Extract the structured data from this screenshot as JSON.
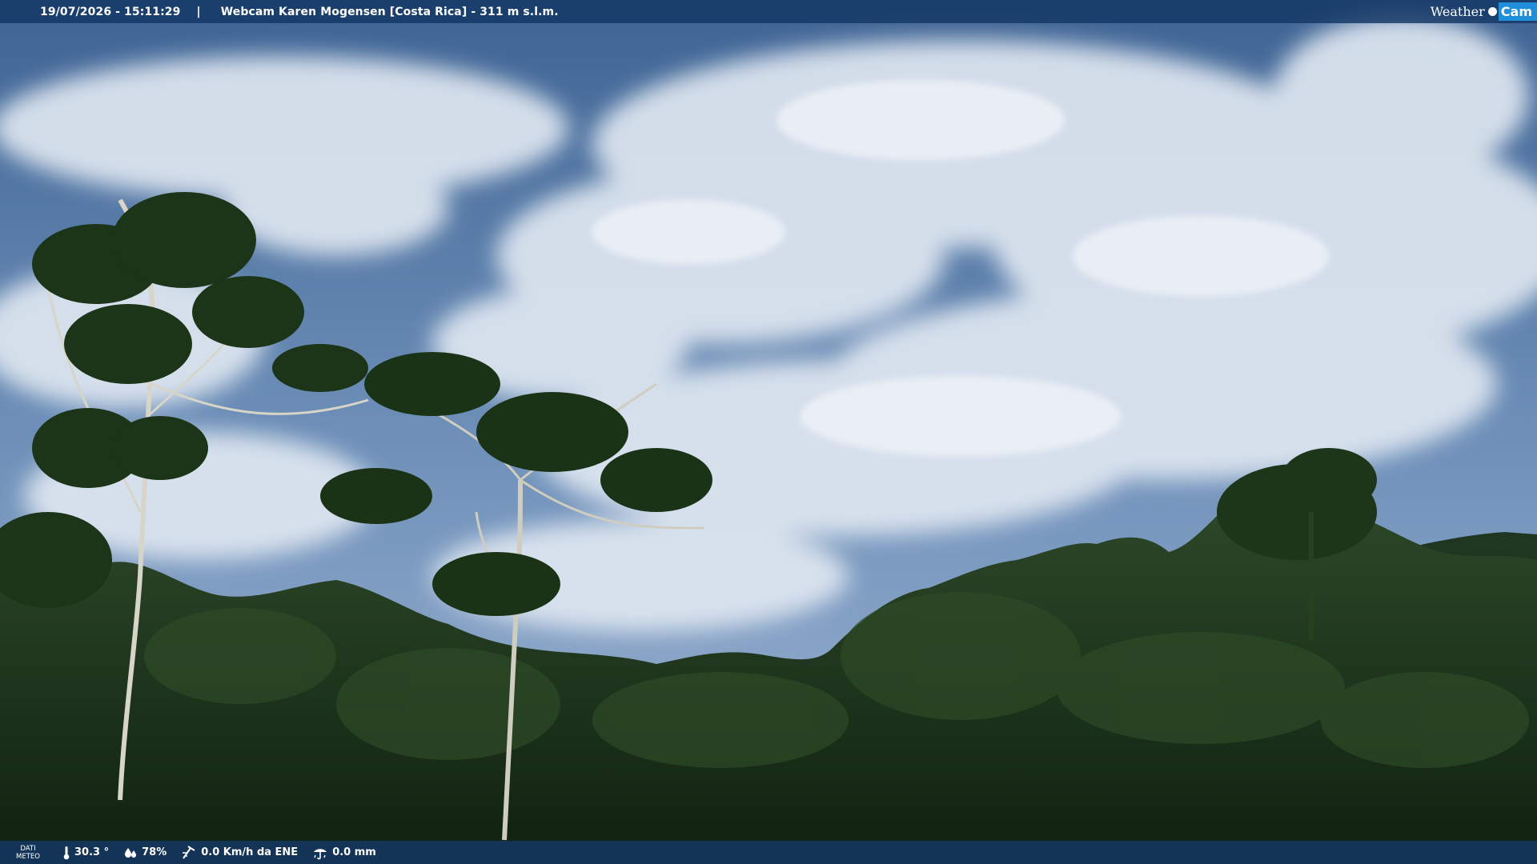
{
  "overlay": {
    "timestamp": "19/07/2026 - 15:11:29",
    "separator": "|",
    "title": "Webcam Karen Mogensen [Costa Rica]  - 311 m s.l.m.",
    "brand": {
      "weather": "Weather",
      "cam": "Cam"
    }
  },
  "weather": {
    "label_line1": "DATI",
    "label_line2": "METEO",
    "temperature": "30.3 °",
    "humidity": "78%",
    "wind": "0.0 Km/h da ENE",
    "rain": "0.0 mm"
  },
  "icons": [
    "thermometer-icon",
    "humidity-drops-icon",
    "wind-icon",
    "rain-gauge-icon"
  ],
  "colors": {
    "bar": "#14376a",
    "brand_accent": "#1e8fd8"
  }
}
